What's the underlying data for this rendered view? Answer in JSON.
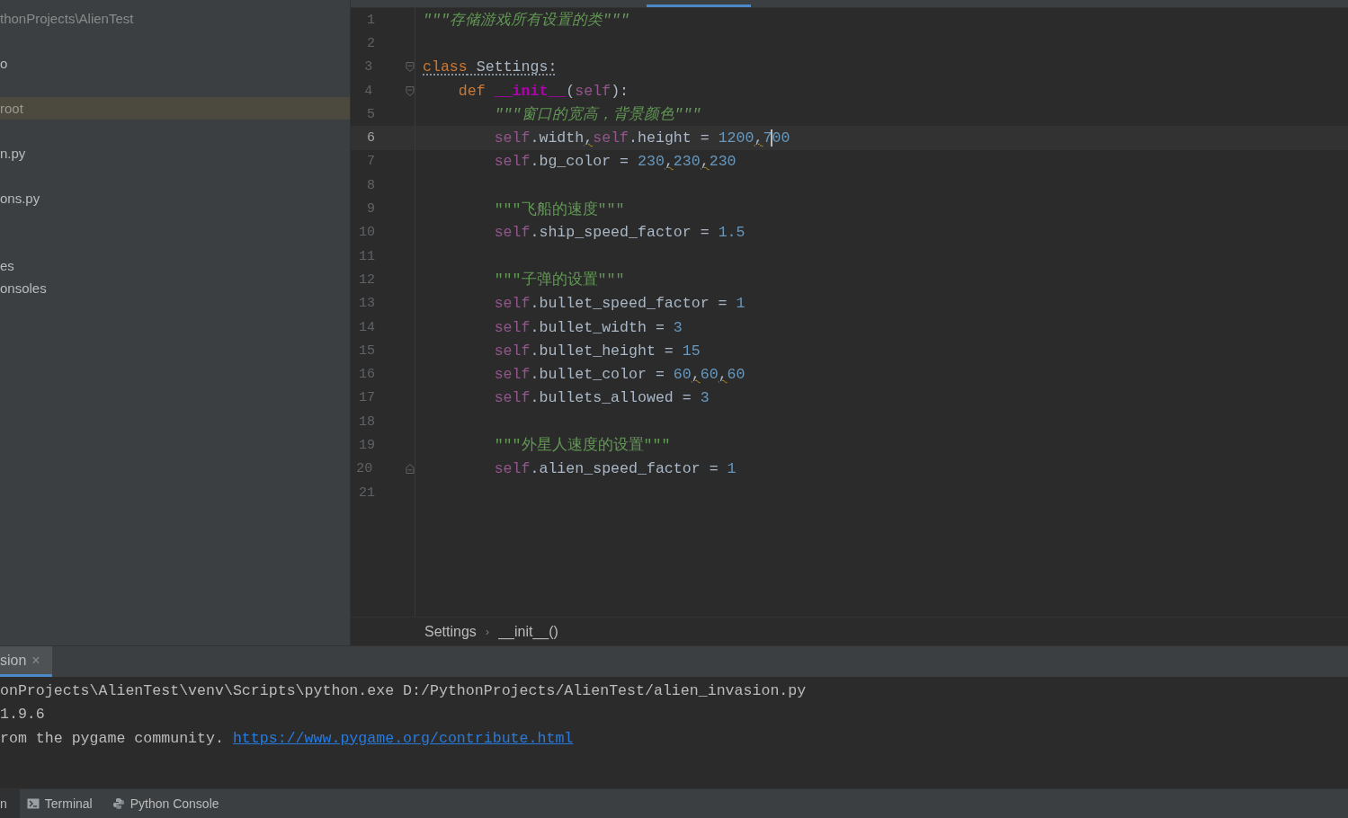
{
  "sidebar": {
    "items": [
      {
        "label": "thonProjects\\AlienTest",
        "kind": "path",
        "selected": false
      },
      {
        "label": "o",
        "kind": "item",
        "selected": false
      },
      {
        "label": "root",
        "kind": "item",
        "selected": true
      },
      {
        "label": "n.py",
        "kind": "item",
        "selected": false
      },
      {
        "label": "ons.py",
        "kind": "item",
        "selected": false
      },
      {
        "label": "es",
        "kind": "item",
        "selected": false
      },
      {
        "label": "onsoles",
        "kind": "item",
        "selected": false
      }
    ]
  },
  "editor": {
    "lines": [
      {
        "number": "1",
        "current": false,
        "tokens": [
          {
            "kind": "docit",
            "text": "\"\"\"存储游戏所有设置的类\"\"\""
          }
        ]
      },
      {
        "number": "2",
        "current": false
      },
      {
        "number": "3",
        "current": false,
        "fold_start": true,
        "warning": true,
        "tokens": [
          {
            "kind": "kw",
            "text": "class"
          },
          {
            "kind": "plain",
            "text": " Settings:"
          }
        ]
      },
      {
        "number": "4",
        "current": false,
        "fold_start": true,
        "tokens": [
          {
            "kind": "kw",
            "text": "    def "
          },
          {
            "kind": "fn",
            "text": "__init__"
          },
          {
            "kind": "plain",
            "text": "("
          },
          {
            "kind": "self",
            "text": "self"
          },
          {
            "kind": "plain",
            "text": "):"
          }
        ]
      },
      {
        "number": "5",
        "current": false,
        "tokens": [
          {
            "kind": "docit",
            "text": "        \"\"\"窗口的宽高，背景颜色\"\"\""
          }
        ]
      },
      {
        "number": "6",
        "current": true,
        "tokens": [
          {
            "kind": "self",
            "text": "        self"
          },
          {
            "kind": "plain",
            "text": ".width"
          },
          {
            "kind": "warn",
            "text": ","
          },
          {
            "kind": "self",
            "text": "self"
          },
          {
            "kind": "plain",
            "text": ".height = "
          },
          {
            "kind": "num",
            "text": "1200"
          },
          {
            "kind": "warn",
            "text": ","
          },
          {
            "kind": "num",
            "text": "7",
            "caret_after": true
          },
          {
            "kind": "num",
            "text": "00"
          }
        ]
      },
      {
        "number": "7",
        "current": false,
        "tokens": [
          {
            "kind": "self",
            "text": "        self"
          },
          {
            "kind": "plain",
            "text": ".bg_color = "
          },
          {
            "kind": "num",
            "text": "230"
          },
          {
            "kind": "warn",
            "text": ","
          },
          {
            "kind": "num",
            "text": "230"
          },
          {
            "kind": "warn",
            "text": ","
          },
          {
            "kind": "num",
            "text": "230"
          }
        ]
      },
      {
        "number": "8",
        "current": false
      },
      {
        "number": "9",
        "current": false,
        "tokens": [
          {
            "kind": "doc",
            "text": "        \"\"\"飞船的速度\"\"\""
          }
        ]
      },
      {
        "number": "10",
        "current": false,
        "tokens": [
          {
            "kind": "self",
            "text": "        self"
          },
          {
            "kind": "plain",
            "text": ".ship_speed_factor = "
          },
          {
            "kind": "num",
            "text": "1.5"
          }
        ]
      },
      {
        "number": "11",
        "current": false
      },
      {
        "number": "12",
        "current": false,
        "tokens": [
          {
            "kind": "doc",
            "text": "        \"\"\"子弹的设置\"\"\""
          }
        ]
      },
      {
        "number": "13",
        "current": false,
        "tokens": [
          {
            "kind": "self",
            "text": "        self"
          },
          {
            "kind": "plain",
            "text": ".bullet_speed_factor = "
          },
          {
            "kind": "num",
            "text": "1"
          }
        ]
      },
      {
        "number": "14",
        "current": false,
        "tokens": [
          {
            "kind": "self",
            "text": "        self"
          },
          {
            "kind": "plain",
            "text": ".bullet_width = "
          },
          {
            "kind": "num",
            "text": "3"
          }
        ]
      },
      {
        "number": "15",
        "current": false,
        "tokens": [
          {
            "kind": "self",
            "text": "        self"
          },
          {
            "kind": "plain",
            "text": ".bullet_height = "
          },
          {
            "kind": "num",
            "text": "15"
          }
        ]
      },
      {
        "number": "16",
        "current": false,
        "tokens": [
          {
            "kind": "self",
            "text": "        self"
          },
          {
            "kind": "plain",
            "text": ".bullet_color = "
          },
          {
            "kind": "num",
            "text": "60"
          },
          {
            "kind": "warn",
            "text": ","
          },
          {
            "kind": "num",
            "text": "60"
          },
          {
            "kind": "warn",
            "text": ","
          },
          {
            "kind": "num",
            "text": "60"
          }
        ]
      },
      {
        "number": "17",
        "current": false,
        "tokens": [
          {
            "kind": "self",
            "text": "        self"
          },
          {
            "kind": "plain",
            "text": ".bullets_allowed = "
          },
          {
            "kind": "num",
            "text": "3"
          }
        ]
      },
      {
        "number": "18",
        "current": false
      },
      {
        "number": "19",
        "current": false,
        "tokens": [
          {
            "kind": "doc",
            "text": "        \"\"\"外星人速度的设置\"\"\""
          }
        ]
      },
      {
        "number": "20",
        "current": false,
        "fold_end": true,
        "tokens": [
          {
            "kind": "self",
            "text": "        self"
          },
          {
            "kind": "plain",
            "text": ".alien_speed_factor = "
          },
          {
            "kind": "num",
            "text": "1"
          }
        ]
      },
      {
        "number": "21",
        "current": false
      }
    ]
  },
  "breadcrumb": [
    {
      "label": "Settings"
    },
    {
      "label": "__init__()"
    }
  ],
  "breadcrumb_separator": "›",
  "run_panel": {
    "tab": {
      "label": "sion",
      "close": "×"
    },
    "lines": [
      {
        "kind": "text",
        "text": "onProjects\\AlienTest\\venv\\Scripts\\python.exe D:/PythonProjects/AlienTest/alien_invasion.py"
      },
      {
        "kind": "text",
        "text": "1.9.6"
      },
      {
        "kind": "link_line",
        "text": "rom the pygame community. ",
        "link": "https://www.pygame.org/contribute.html"
      }
    ]
  },
  "tool_windows": [
    {
      "label": "n",
      "kind": "run",
      "selected": true
    },
    {
      "label": "Terminal",
      "kind": "terminal",
      "selected": false
    },
    {
      "label": "Python Console",
      "kind": "python",
      "selected": false
    }
  ]
}
